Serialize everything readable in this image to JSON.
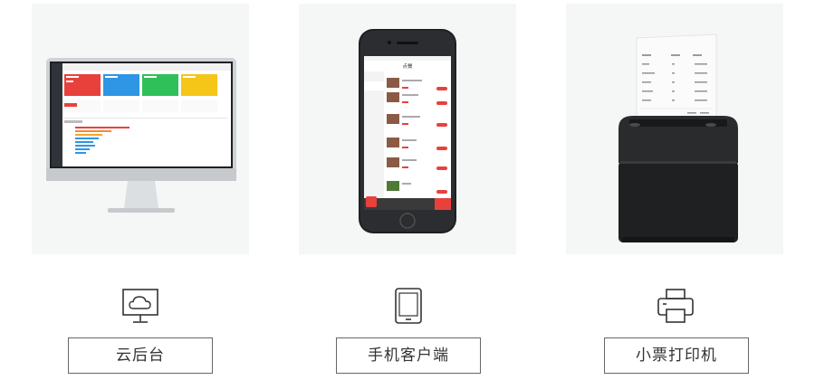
{
  "colors": {
    "card_bg": "#f5f6f6",
    "accent_red": "#e8413c",
    "tile_blue": "#2f95e5",
    "tile_green": "#2fc05a",
    "tile_yellow": "#f5c518",
    "border": "#666666"
  },
  "features": [
    {
      "label": "云后台",
      "icon": "cloud-monitor-icon"
    },
    {
      "label": "手机客户端",
      "icon": "tablet-icon"
    },
    {
      "label": "小票打印机",
      "icon": "printer-icon"
    }
  ],
  "phone_screen": {
    "title": "点餐",
    "menu_items": [
      "爆款猪肉(精华)",
      "羊肉",
      "鸭肉",
      "牛肉",
      "蔬菜"
    ],
    "cart_total": "¥ 216",
    "checkout_label": "去下单"
  },
  "receipt": {
    "headers": [
      "名称",
      "数量",
      "金额"
    ],
    "rows": [
      [
        "名称",
        "3",
        "¥ 40.00"
      ],
      [
        "肥牛卷",
        "1",
        "¥ 20.00"
      ],
      [
        "肉丸",
        "1",
        "¥ 36.00"
      ],
      [
        "羊肉卷",
        "1",
        "¥ 38.00"
      ],
      [
        "鸭肠",
        "1",
        "¥ 76.00"
      ]
    ],
    "total": "¥ 175"
  }
}
